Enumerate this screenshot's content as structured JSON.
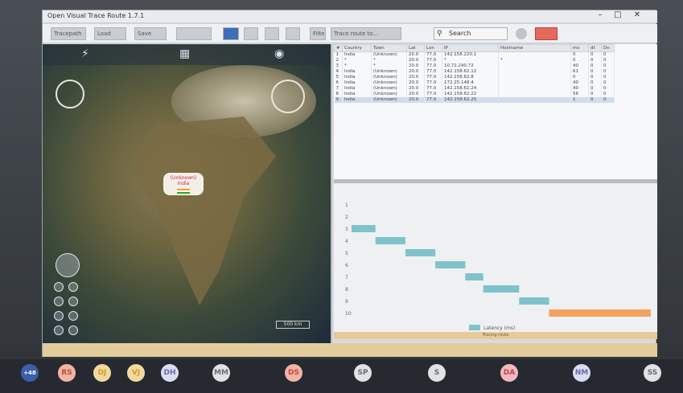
{
  "window": {
    "title": "Open Visual Trace Route 1.7.1",
    "controls": [
      "–",
      "□",
      "✕"
    ]
  },
  "toolbar": {
    "items": [
      "Tracepath",
      "Load",
      "Save",
      "",
      "",
      "",
      "",
      "",
      "",
      "Filter",
      "Trace route to..."
    ],
    "search_label": "Search",
    "search_icon": "search-icon"
  },
  "map": {
    "popup_title": "(Unknown)",
    "popup_sub": "India",
    "scale_label": "500 km"
  },
  "table": {
    "columns": [
      "#",
      "Country",
      "Town",
      "Lat",
      "Lon",
      "IP",
      "Hostname",
      "ms",
      "dt",
      "Dn"
    ],
    "rows": [
      [
        "1",
        "India",
        "(Unknown)",
        "20.0",
        "77.0",
        "142.158.220.1",
        "",
        "0",
        "0",
        "0"
      ],
      [
        "2",
        "*",
        "*",
        "20.0",
        "77.0",
        "*",
        "*",
        "0",
        "0",
        "0"
      ],
      [
        "3",
        "*",
        "*",
        "20.0",
        "77.0",
        "10.72.240.72",
        "",
        "40",
        "0",
        "0"
      ],
      [
        "4",
        "India",
        "(Unknown)",
        "20.0",
        "77.0",
        "142.158.62.12",
        "",
        "61",
        "0",
        "0"
      ],
      [
        "5",
        "India",
        "(Unknown)",
        "20.0",
        "77.0",
        "142.158.62.8",
        "",
        "0",
        "0",
        "0"
      ],
      [
        "6",
        "India",
        "(Unknown)",
        "20.0",
        "77.0",
        "172.25.148.4",
        "",
        "40",
        "0",
        "0"
      ],
      [
        "7",
        "India",
        "(Unknown)",
        "20.0",
        "77.0",
        "142.158.62.24",
        "",
        "40",
        "0",
        "0"
      ],
      [
        "8",
        "India",
        "(Unknown)",
        "20.0",
        "77.0",
        "142.158.62.22",
        "",
        "56",
        "0",
        "0"
      ],
      [
        "9",
        "India",
        "(Unknown)",
        "20.0",
        "77.0",
        "142.158.62.25",
        "",
        "1",
        "0",
        "0"
      ]
    ]
  },
  "chart_data": {
    "type": "bar",
    "orientation": "horizontal-gantt",
    "categories": [
      "1",
      "2",
      "3",
      "4",
      "5",
      "6",
      "7",
      "8",
      "9",
      "10"
    ],
    "series": [
      {
        "name": "Latency (ms)",
        "segments": [
          [
            0,
            0
          ],
          [
            0,
            0
          ],
          [
            0,
            8
          ],
          [
            8,
            18
          ],
          [
            18,
            28
          ],
          [
            28,
            38
          ],
          [
            38,
            44
          ],
          [
            44,
            56
          ],
          [
            56,
            66
          ],
          [
            66,
            100
          ]
        ]
      }
    ],
    "colors": [
      "#7fc2cc",
      "#f2a35e"
    ],
    "legend": "Latency (ms)",
    "status_text": "Tracing route"
  },
  "meeting": {
    "you_label": "+48",
    "participants": [
      "RS",
      "DJ",
      "VJ",
      "DH",
      "MM",
      "DS",
      "SP",
      "S",
      "DA",
      "NM",
      "SS"
    ]
  }
}
